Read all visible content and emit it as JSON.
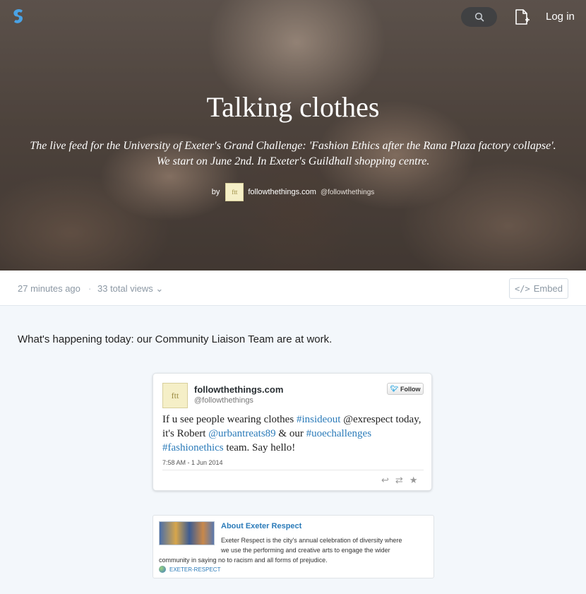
{
  "header": {
    "login_label": "Log in"
  },
  "story": {
    "title": "Talking clothes",
    "description_line1": "The live feed for the University of Exeter's Grand Challenge: 'Fashion Ethics after the Rana Plaza factory collapse'.",
    "description_line2": "We start on June 2nd. In Exeter's Guildhall shopping centre.",
    "by_label": "by",
    "author_avatar_text": "ftt",
    "author_name": "followthethings.com",
    "author_handle": "@followthethings"
  },
  "meta": {
    "time_ago": "27 minutes ago",
    "separator": "·",
    "views": "33 total views ⌄",
    "embed_label": "Embed",
    "embed_icon": "</>"
  },
  "content": {
    "intro_text": "What's happening today: our Community Liaison Team are at work.",
    "tweet": {
      "avatar_text": "ftt",
      "name": "followthethings.com",
      "handle": "@followthethings",
      "follow_label": "Follow",
      "text_parts": {
        "p1": "If u see people wearing clothes ",
        "h1": "#insideout",
        "p2": " @exrespect today, it's Robert ",
        "m1": "@urbantreats89",
        "p3": " & our ",
        "h2": "#uoechallenges",
        "p4": " ",
        "h3": "#fashionethics",
        "p5": " team. Say hello!"
      },
      "date": "7:58 AM - 1 Jun 2014"
    },
    "link_card": {
      "title": "About Exeter Respect",
      "desc_line1": "Exeter Respect is the city's annual celebration of diversity where",
      "desc_line2": "we use the performing and creative arts to engage the wider",
      "desc_line3": "community in saying no to racism and all forms of prejudice.",
      "source": "EXETER-RESPECT"
    }
  },
  "colors": {
    "link": "#2b7bb9",
    "muted": "#8c98a4",
    "page_bg": "#f3f7fb"
  }
}
